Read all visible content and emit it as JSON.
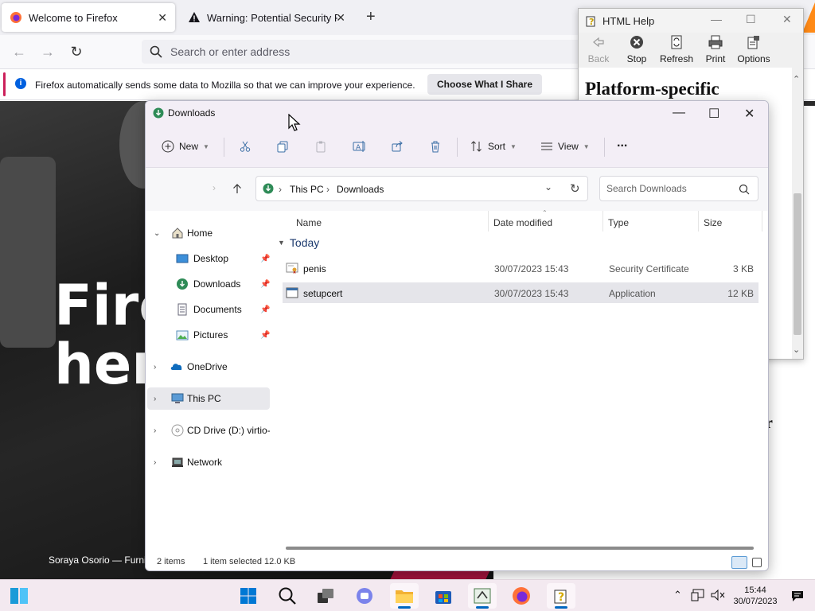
{
  "firefox": {
    "tabs": [
      {
        "title": "Welcome to Firefox",
        "active": true
      },
      {
        "title": "Warning: Potential Security Risk Ahead",
        "active": false
      }
    ],
    "new_tab": "+",
    "address_placeholder": "Search or enter address",
    "notice": {
      "message": "Firefox automatically sends some data to Mozilla so that we can improve your experience.",
      "button": "Choose What I Share"
    },
    "hero": {
      "title_line1": "Fire",
      "title_line2": "her",
      "caption": "Soraya Osorio — Furnit"
    },
    "right_fragments": {
      "frag1": "or",
      "frag2": "r"
    }
  },
  "help": {
    "title": "HTML Help",
    "toolbar": [
      {
        "label": "Back",
        "icon": "back-arrow-icon",
        "enabled": false
      },
      {
        "label": "Stop",
        "icon": "stop-icon",
        "enabled": true
      },
      {
        "label": "Refresh",
        "icon": "refresh-icon",
        "enabled": true
      },
      {
        "label": "Print",
        "icon": "printer-icon",
        "enabled": true
      },
      {
        "label": "Options",
        "icon": "options-icon",
        "enabled": true
      }
    ],
    "heading": "Platform-specific"
  },
  "explorer": {
    "title": "Downloads",
    "commands": {
      "new": "New",
      "sort": "Sort",
      "view": "View",
      "more": "..."
    },
    "breadcrumb": [
      "This PC",
      "Downloads"
    ],
    "search_placeholder": "Search Downloads",
    "nav": [
      {
        "label": "Home",
        "icon": "home-icon",
        "expanded": true
      },
      {
        "label": "Desktop",
        "icon": "desktop-icon",
        "pinned": true
      },
      {
        "label": "Downloads",
        "icon": "downloads-icon",
        "pinned": true
      },
      {
        "label": "Documents",
        "icon": "documents-icon",
        "pinned": true
      },
      {
        "label": "Pictures",
        "icon": "pictures-icon",
        "pinned": true
      },
      {
        "label": "OneDrive",
        "icon": "cloud-icon"
      },
      {
        "label": "This PC",
        "icon": "computer-icon",
        "selected": true
      },
      {
        "label": "CD Drive (D:) virtio-w",
        "icon": "disc-icon"
      },
      {
        "label": "Network",
        "icon": "network-icon"
      }
    ],
    "columns": [
      "Name",
      "Date modified",
      "Type",
      "Size"
    ],
    "group": "Today",
    "files": [
      {
        "name": "penis",
        "date": "30/07/2023 15:43",
        "type": "Security Certificate",
        "size": "3 KB",
        "icon": "certificate-icon",
        "selected": false
      },
      {
        "name": "setupcert",
        "date": "30/07/2023 15:43",
        "type": "Application",
        "size": "12 KB",
        "icon": "application-icon",
        "selected": true
      }
    ],
    "status": {
      "items": "2 items",
      "selected": "1 item selected  12.0 KB"
    }
  },
  "taskbar": {
    "time": "15:44",
    "date": "30/07/2023"
  },
  "colors": {
    "accent": "#0067c0",
    "firefox_notice_bar": "#cc1f5a",
    "explorer_chrome": "#f3eef6",
    "taskbar": "#f3e9f0"
  }
}
